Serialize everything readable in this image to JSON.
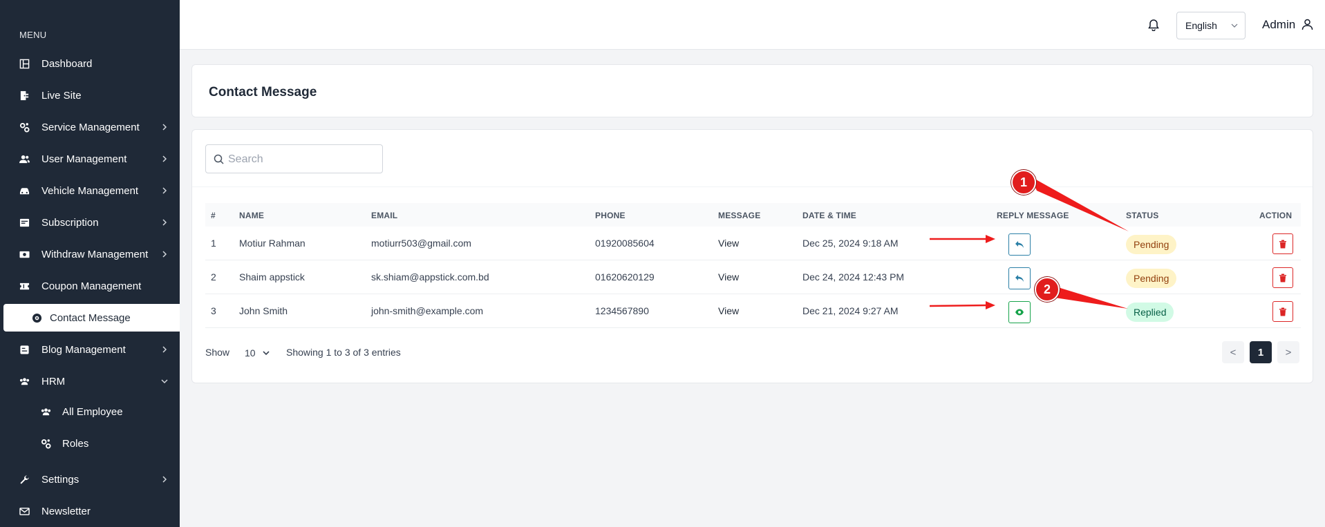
{
  "sidebar": {
    "menu_label": "MENU",
    "items": [
      {
        "label": "Dashboard"
      },
      {
        "label": "Live Site"
      },
      {
        "label": "Service Management"
      },
      {
        "label": "User Management"
      },
      {
        "label": "Vehicle Management"
      },
      {
        "label": "Subscription"
      },
      {
        "label": "Withdraw Management"
      },
      {
        "label": "Coupon Management"
      },
      {
        "label": "Contact Message"
      },
      {
        "label": "Blog Management"
      },
      {
        "label": "HRM"
      },
      {
        "label": "All Employee"
      },
      {
        "label": "Roles"
      },
      {
        "label": "Settings"
      },
      {
        "label": "Newsletter"
      }
    ]
  },
  "topbar": {
    "language": "English",
    "user": "Admin"
  },
  "page": {
    "title": "Contact Message"
  },
  "search": {
    "placeholder": "Search"
  },
  "table": {
    "headers": [
      "#",
      "NAME",
      "EMAIL",
      "PHONE",
      "MESSAGE",
      "DATE & TIME",
      "REPLY MESSAGE",
      "STATUS",
      "ACTION"
    ],
    "rows": [
      {
        "num": "1",
        "name": "Motiur Rahman",
        "email": "motiurr503@gmail.com",
        "phone": "01920085604",
        "message": "View",
        "datetime": "Dec 25, 2024 9:18 AM",
        "status": "Pending"
      },
      {
        "num": "2",
        "name": "Shaim appstick",
        "email": "sk.shiam@appstick.com.bd",
        "phone": "01620620129",
        "message": "View",
        "datetime": "Dec 24, 2024 12:43 PM",
        "status": "Pending"
      },
      {
        "num": "3",
        "name": "John Smith",
        "email": "john-smith@example.com",
        "phone": "1234567890",
        "message": "View",
        "datetime": "Dec 21, 2024 9:27 AM",
        "status": "Replied"
      }
    ]
  },
  "footer": {
    "show_label": "Show",
    "page_size": "10",
    "entries_text": "Showing 1 to 3 of 3 entries",
    "prev": "<",
    "current_page": "1",
    "next": ">"
  },
  "annotations": {
    "marker_1": "1",
    "marker_2": "2"
  },
  "colors": {
    "sidebar_bg": "#1f2937",
    "pending_bg": "#fef3c7",
    "replied_bg": "#d1fae5",
    "delete_red": "#dc2626",
    "annotation_red": "#e11d1d"
  }
}
